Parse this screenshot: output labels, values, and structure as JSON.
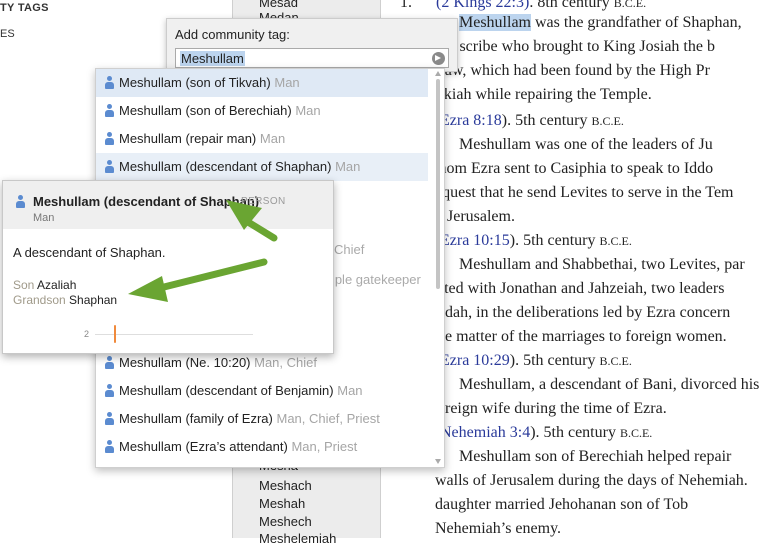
{
  "left_panel": {
    "header": "TY TAGS",
    "row": "ES"
  },
  "names": [
    "Mesad",
    "Medan",
    "Mesha",
    "Meshach",
    "Meshah",
    "Meshech",
    "Meshelemiah"
  ],
  "article": {
    "number": "1.",
    "lines": [
      {
        "ref": "(2 Kings 22:3)",
        "rest": ". 8th century ",
        "bce": "B.C.E."
      },
      {
        "hl": "Meshullam",
        "rest": " was the grandfather of Shaphan,"
      },
      {
        "text": "rt’s scribe who brought to King Josiah the b"
      },
      {
        "text": "Law, which had been found by the High Pr"
      },
      {
        "text": "ilkiah while repairing the Temple."
      },
      {
        "ref": "Ezra 8:18",
        "rest": "). 5th century ",
        "bce": "B.C.E."
      },
      {
        "text": "Meshullam was one of the leaders of Ju"
      },
      {
        "text": "whom Ezra sent to Casiphia to speak to Iddo"
      },
      {
        "text": "equest that he send Levites to serve in the Tem"
      },
      {
        "text": "n Jerusalem."
      },
      {
        "ref": "Ezra 10:15",
        "rest": "). 5th century ",
        "bce": "B.C.E."
      },
      {
        "text": "Meshullam and Shabbethai, two Levites, par"
      },
      {
        "text": "ated with Jonathan and Jahzeiah, two leaders"
      },
      {
        "text": "udah, in the deliberations led by Ezra concern"
      },
      {
        "text": "he matter of the marriages to foreign women."
      },
      {
        "ref": "Ezra 10:29",
        "rest": "). 5th century ",
        "bce": "B.C.E."
      },
      {
        "text": "Meshullam, a descendant of Bani, divorced his"
      },
      {
        "text": "oreign wife during the time of Ezra."
      },
      {
        "ref": "Nehemiah 3:4",
        "rest": "). 5th century ",
        "bce": "B.C.E."
      },
      {
        "text": "Meshullam son of Berechiah helped repair"
      },
      {
        "text": "walls of Jerusalem during the days of Nehemiah."
      },
      {
        "text": "daughter married Jehohanan son of Tob"
      },
      {
        "text": "Nehemiah’s enemy."
      }
    ]
  },
  "tag_popup": {
    "label": "Add community tag:",
    "input_value": "Meshullam"
  },
  "suggestions": [
    {
      "name": "Meshullam (son of Tikvah)",
      "desc": "Man"
    },
    {
      "name": "Meshullam (son of Berechiah)",
      "desc": "Man"
    },
    {
      "name": "Meshullam (repair man)",
      "desc": "Man"
    },
    {
      "name": "Meshullam (descendant of Shaphan)",
      "desc": "Man"
    },
    {
      "name": "Meshullam (Ne. 10:20)",
      "desc": "Man, Chief"
    },
    {
      "name": "Meshullam (descendant of Benjamin)",
      "desc": "Man"
    },
    {
      "name": "Meshullam (family of Ezra)",
      "desc": "Man, Chief, Priest"
    },
    {
      "name": "Meshullam (Ezra’s attendant)",
      "desc": "Man, Priest"
    }
  ],
  "ghost_fragments": [
    "Chief",
    "mple gatekeeper"
  ],
  "card": {
    "title": "Meshullam (descendant of Shaphan)",
    "kind": "PERSON",
    "subtitle": "Man",
    "description": "A descendant of Shaphan.",
    "relations": [
      {
        "key": "Son",
        "value": "Azaliah"
      },
      {
        "key": "Grandson",
        "value": "Shaphan"
      }
    ],
    "timeline_label": "2"
  },
  "colors": {
    "highlight": "#bcd4ee",
    "reference_link": "#2a3a9a",
    "arrow": "#6aa532",
    "timeline_marker": "#f08a3c",
    "person_icon": "#5b8bd0"
  }
}
